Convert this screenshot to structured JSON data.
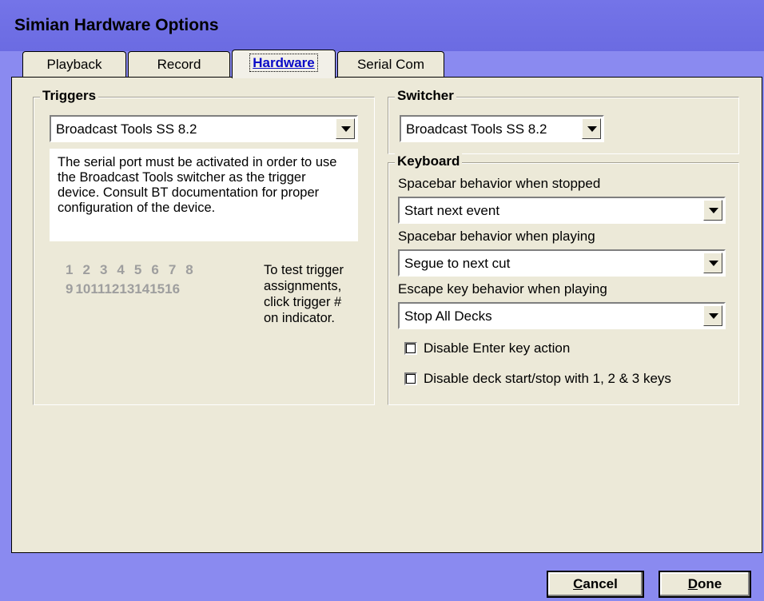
{
  "window": {
    "title": "Simian Hardware Options"
  },
  "tabs": [
    {
      "label": "Playback"
    },
    {
      "label": "Record"
    },
    {
      "label": "Hardware",
      "active": true
    },
    {
      "label": "Serial Com"
    }
  ],
  "triggers": {
    "legend": "Triggers",
    "device": "Broadcast Tools SS 8.2",
    "note": "The serial port must be activated in order to use the Broadcast Tools switcher as the trigger device. Consult BT documentation for proper configuration of the device.",
    "row1": [
      "1",
      "2",
      "3",
      "4",
      "5",
      "6",
      "7",
      "8"
    ],
    "row2": [
      "9",
      "10",
      "11",
      "12",
      "13",
      "14",
      "15",
      "16"
    ],
    "hint": "To test trigger assignments, click trigger # on indicator."
  },
  "switcher": {
    "legend": "Switcher",
    "device": "Broadcast Tools SS 8.2"
  },
  "keyboard": {
    "legend": "Keyboard",
    "stopped_label": "Spacebar behavior when stopped",
    "stopped_value": "Start next event",
    "playing_label": "Spacebar behavior when playing",
    "playing_value": "Segue to next cut",
    "escape_label": "Escape key behavior when playing",
    "escape_value": "Stop All Decks",
    "disable_enter": {
      "label": "Disable Enter key action",
      "checked": false
    },
    "disable_deck": {
      "label": "Disable deck start/stop with 1, 2 & 3 keys",
      "checked": false
    }
  },
  "buttons": {
    "cancel_rest": "ancel",
    "cancel_mnemonic": "C",
    "done_rest": "one",
    "done_mnemonic": "D"
  },
  "colors": {
    "window_frame": "#8A8AF0",
    "title_bar": "#6B6BE2",
    "panel": "#ECE9D8",
    "active_tab_text": "#0A0AC8",
    "trigger_digits": "#9E9E9E"
  }
}
